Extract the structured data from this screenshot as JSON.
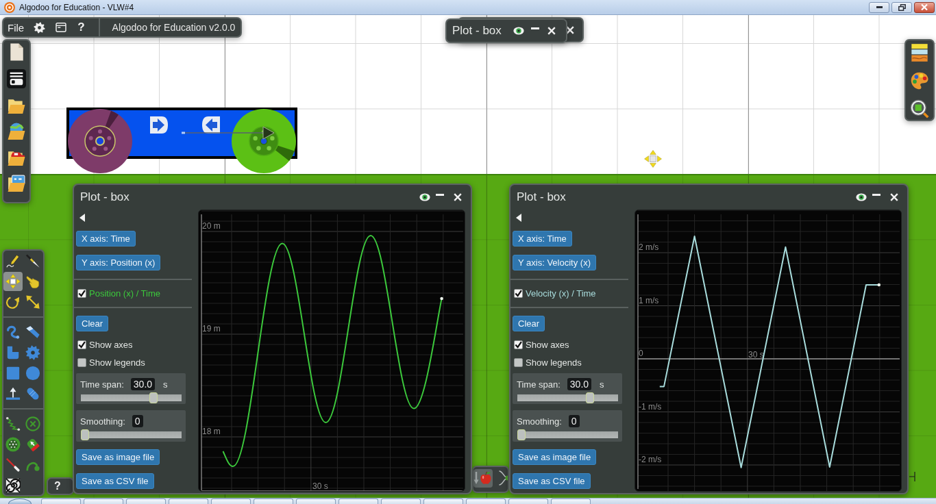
{
  "window": {
    "title": "Algodoo for Education - VLW#4"
  },
  "main_toolbar": {
    "menu": "File",
    "help": "?",
    "version": "Algodoo for Education v2.0.0"
  },
  "collapsed_plot": {
    "title": "Plot - box"
  },
  "view_toolbar": {
    "items": [
      {
        "kind": "material"
      },
      {
        "kind": "appearance"
      },
      {
        "kind": "zoom"
      }
    ]
  },
  "file_sidebar": {
    "items": [
      {
        "kind": "new"
      },
      {
        "kind": "save"
      },
      {
        "kind": "open"
      },
      {
        "kind": "online"
      },
      {
        "kind": "scene"
      },
      {
        "kind": "lesson"
      }
    ]
  },
  "tool_panel": {
    "groups": [
      {
        "tools": [
          {
            "kind": "sketch",
            "selected": false
          },
          {
            "kind": "cut",
            "selected": false
          },
          {
            "kind": "move",
            "selected": true
          },
          {
            "kind": "drag",
            "selected": false
          },
          {
            "kind": "rotate",
            "selected": false
          },
          {
            "kind": "scale",
            "selected": false
          }
        ]
      },
      {
        "tools": [
          {
            "kind": "rope",
            "selected": false
          },
          {
            "kind": "brush",
            "selected": false
          },
          {
            "kind": "polygon",
            "selected": false
          },
          {
            "kind": "gear",
            "selected": false
          },
          {
            "kind": "box",
            "selected": false
          },
          {
            "kind": "circle",
            "selected": false
          },
          {
            "kind": "plane",
            "selected": false
          },
          {
            "kind": "chain",
            "selected": false
          }
        ]
      },
      {
        "tools": [
          {
            "kind": "spring",
            "selected": false
          },
          {
            "kind": "fixate",
            "selected": false
          },
          {
            "kind": "axle",
            "selected": false
          },
          {
            "kind": "tracer",
            "selected": false
          },
          {
            "kind": "laser",
            "selected": false
          },
          {
            "kind": "hinge",
            "selected": false
          },
          {
            "kind": "texture",
            "selected": false
          }
        ]
      }
    ]
  },
  "plots": [
    {
      "title": "Plot - box",
      "x_axis": "X axis: Time",
      "y_axis": "Y axis: Position (x)",
      "series": [
        {
          "label": "Position (x) / Time",
          "checked": true,
          "color": "#3cc83c"
        }
      ],
      "clear": "Clear",
      "options": [
        {
          "label": "Show axes",
          "checked": true
        },
        {
          "label": "Show legends",
          "checked": false
        }
      ],
      "time_span": {
        "label": "Time span:",
        "value": "30.0",
        "unit": "s",
        "level": 0.74
      },
      "smoothing": {
        "label": "Smoothing:",
        "value": "0",
        "level": 0
      },
      "save_buttons": [
        "Save as image file",
        "Save as CSV file"
      ],
      "graph": {
        "kind": "smooth",
        "y_labels": [
          "20 m",
          "19 m",
          "18 m"
        ],
        "x_labels": [
          "30 s"
        ]
      }
    },
    {
      "title": "Plot - box",
      "x_axis": "X axis: Time",
      "y_axis": "Y axis: Velocity (x)",
      "series": [
        {
          "label": "Velocity (x) / Time",
          "checked": true,
          "color": "#a8dcdc"
        }
      ],
      "clear": "Clear",
      "options": [
        {
          "label": "Show axes",
          "checked": true
        },
        {
          "label": "Show legends",
          "checked": false
        }
      ],
      "time_span": {
        "label": "Time span:",
        "value": "30.0",
        "unit": "s",
        "level": 0.74
      },
      "smoothing": {
        "label": "Smoothing:",
        "value": "0",
        "level": 0
      },
      "save_buttons": [
        "Save as image file",
        "Save as CSV file"
      ],
      "graph": {
        "kind": "angular",
        "y_labels": [
          "2 m/s",
          "1 m/s",
          "0",
          "-1 m/s",
          "-2 m/s"
        ],
        "x_labels": [
          "30 s"
        ]
      }
    }
  ],
  "help_bar": {
    "help": "?"
  }
}
